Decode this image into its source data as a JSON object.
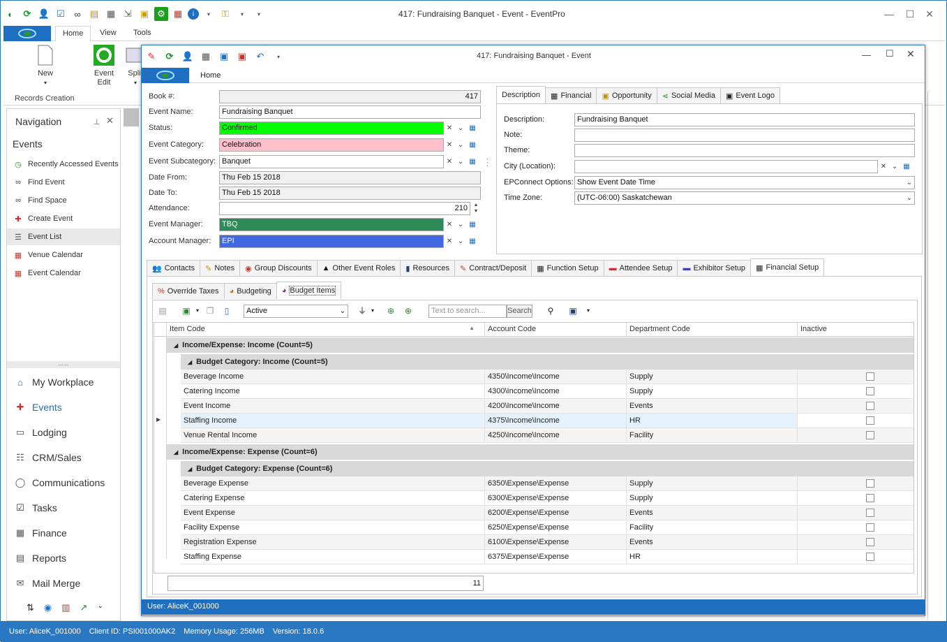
{
  "app": {
    "title": "417: Fundraising Banquet - Event - EventPro",
    "ribbon_tabs": [
      "Home",
      "View",
      "Tools"
    ],
    "ribbon_buttons": {
      "new": "New",
      "event_edit": "Event\nEdit",
      "split": "Split"
    },
    "group_label": "Records Creation"
  },
  "navigation": {
    "header": "Navigation",
    "section": "Events",
    "items": [
      {
        "label": "Recently Accessed Events",
        "icon": "clock-icon"
      },
      {
        "label": "Find Event",
        "icon": "binoculars-icon"
      },
      {
        "label": "Find Space",
        "icon": "binoculars-icon"
      },
      {
        "label": "Create Event",
        "icon": "pin-icon"
      },
      {
        "label": "Event List",
        "icon": "list-icon"
      },
      {
        "label": "Venue Calendar",
        "icon": "calendar-icon"
      },
      {
        "label": "Event Calendar",
        "icon": "calendar-icon"
      }
    ],
    "modules": [
      {
        "label": "My Workplace"
      },
      {
        "label": "Events"
      },
      {
        "label": "Lodging"
      },
      {
        "label": "CRM/Sales"
      },
      {
        "label": "Communications"
      },
      {
        "label": "Tasks"
      },
      {
        "label": "Finance"
      },
      {
        "label": "Reports"
      },
      {
        "label": "Mail Merge"
      }
    ],
    "grip": "......"
  },
  "status": {
    "user": "User: AliceK_001000",
    "client": "Client ID: PSI001000AK2",
    "memory": "Memory Usage: 256MB",
    "version": "Version: 18.0.6"
  },
  "event_window": {
    "title": "417: Fundraising Banquet - Event",
    "tab": "Home",
    "status_user": "User: AliceK_001000",
    "fields": {
      "book_label": "Book #:",
      "book": "417",
      "name_label": "Event Name:",
      "name": "Fundraising Banquet",
      "status_label": "Status:",
      "status": "Confirmed",
      "category_label": "Event Category:",
      "category": "Celebration",
      "subcategory_label": "Event Subcategory:",
      "subcategory": "Banquet",
      "date_from_label": "Date From:",
      "date_from": "Thu Feb 15 2018",
      "date_to_label": "Date To:",
      "date_to": "Thu Feb 15 2018",
      "attendance_label": "Attendance:",
      "attendance": "210",
      "manager_label": "Event Manager:",
      "manager": "TBQ",
      "account_label": "Account Manager:",
      "account": "EPI"
    },
    "colors": {
      "status": "#00ff00",
      "category": "#ffc0cb",
      "manager": "#2e8b57",
      "account": "#4169e1"
    },
    "desc_tabs": [
      "Description",
      "Financial",
      "Opportunity",
      "Social Media",
      "Event Logo"
    ],
    "desc": {
      "description_label": "Description:",
      "description": "Fundraising Banquet",
      "note_label": "Note:",
      "note": "",
      "theme_label": "Theme:",
      "theme": "",
      "city_label": "City (Location):",
      "city": "",
      "epconnect_label": "EPConnect Options:",
      "epconnect": "Show Event Date Time",
      "timezone_label": "Time Zone:",
      "timezone": "(UTC-06:00) Saskatchewan"
    },
    "main_tabs": [
      "Contacts",
      "Notes",
      "Group Discounts",
      "Other Event Roles",
      "Resources",
      "Contract/Deposit",
      "Function Setup",
      "Attendee Setup",
      "Exhibitor Setup",
      "Financial Setup"
    ],
    "sub_tabs": [
      "Override Taxes",
      "Budgeting",
      "Budget Items"
    ],
    "toolbar": {
      "filter": "Active",
      "search_placeholder": "Text to search...",
      "search_button": "Search"
    },
    "grid": {
      "columns": [
        "Item Code",
        "Account Code",
        "Department Code",
        "Inactive"
      ],
      "groups": [
        {
          "header": "Income/Expense: Income (Count=5)",
          "sub": "Budget Category: Income (Count=5)",
          "rows": [
            {
              "item": "Beverage Income",
              "account": "4350\\Income\\Income",
              "dept": "Supply"
            },
            {
              "item": "Catering Income",
              "account": "4300\\Income\\Income",
              "dept": "Supply"
            },
            {
              "item": "Event Income",
              "account": "4200\\Income\\Income",
              "dept": "Events"
            },
            {
              "item": "Staffing Income",
              "account": "4375\\Income\\Income",
              "dept": "HR"
            },
            {
              "item": "Venue Rental Income",
              "account": "4250\\Income\\Income",
              "dept": "Facility"
            }
          ]
        },
        {
          "header": "Income/Expense: Expense (Count=6)",
          "sub": "Budget Category: Expense (Count=6)",
          "rows": [
            {
              "item": "Beverage Expense",
              "account": "6350\\Expense\\Expense",
              "dept": "Supply"
            },
            {
              "item": "Catering Expense",
              "account": "6300\\Expense\\Expense",
              "dept": "Supply"
            },
            {
              "item": "Event Expense",
              "account": "6200\\Expense\\Expense",
              "dept": "Events"
            },
            {
              "item": "Facility Expense",
              "account": "6250\\Expense\\Expense",
              "dept": "Facility"
            },
            {
              "item": "Registration Expense",
              "account": "6100\\Expense\\Expense",
              "dept": "Events"
            },
            {
              "item": "Staffing Expense",
              "account": "6375\\Expense\\Expense",
              "dept": "HR"
            }
          ]
        }
      ],
      "footer_count": "11"
    }
  }
}
